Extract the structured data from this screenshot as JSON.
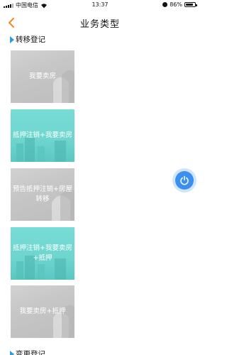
{
  "status_bar": {
    "carrier": "中国电信",
    "time": "13:37",
    "battery": "86%",
    "battery_level": 0.86
  },
  "header": {
    "title": "业务类型"
  },
  "sections": [
    {
      "title": "转移登记",
      "cards": [
        {
          "label": "我要卖房",
          "style": "gray"
        },
        {
          "label": "抵押注销+我要卖房",
          "style": "teal"
        },
        {
          "label": "预告抵押注销+房屋转移",
          "style": "gray"
        },
        {
          "label": "抵押注销+我要卖房+抵押",
          "style": "teal"
        },
        {
          "label": "我要卖房+抵押",
          "style": "gray"
        }
      ]
    },
    {
      "title": "变更登记"
    }
  ],
  "colors": {
    "accent": "#f08a24",
    "section_marker": "#2d9bd6",
    "card_gray": "#c6c6c6",
    "card_teal": "#6fd6cf",
    "power_button": "#3b8ff0"
  },
  "icons": {
    "back": "chevron-left-icon",
    "power": "power-icon"
  }
}
